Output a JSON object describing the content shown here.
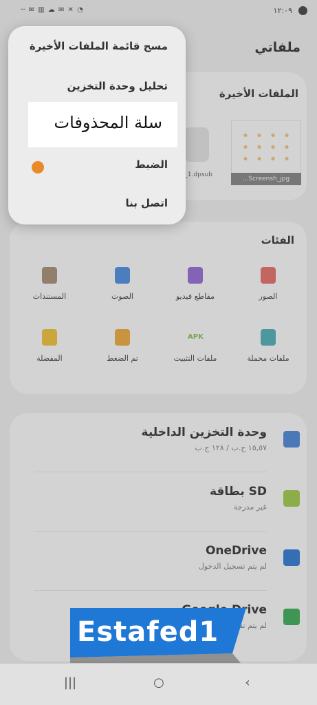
{
  "status_bar": {
    "time": "١٢:٠٩",
    "left_icons": "ⵈ ✉ ▥ ☁ ✉ ✕ ◔"
  },
  "app": {
    "title": "ملفاتي"
  },
  "recent": {
    "title": "الملفات الأخيرة",
    "file_1_name": "...Screensh_jpg",
    "file_2_name": "...5_1.dpsub"
  },
  "categories": {
    "title": "الفئات",
    "items": [
      {
        "label": "الصور",
        "icon": "image-icon",
        "color": "#e8625b"
      },
      {
        "label": "مقاطع فيديو",
        "icon": "video-icon",
        "color": "#8c5fd6"
      },
      {
        "label": "الصوت",
        "icon": "music-icon",
        "color": "#3b86e0"
      },
      {
        "label": "المستندات",
        "icon": "document-icon",
        "color": "#a4846a"
      },
      {
        "label": "ملفات محملة",
        "icon": "download-icon",
        "color": "#3fa9b5"
      },
      {
        "label": "ملفات التثبيت",
        "icon": "apk-icon",
        "color": "#7cc04a",
        "icon_text": "APK"
      },
      {
        "label": "تم الضغط",
        "icon": "folder-icon",
        "color": "#f0a52a"
      },
      {
        "label": "المفضلة",
        "icon": "star-icon",
        "color": "#f2c029"
      }
    ]
  },
  "storage": {
    "items": [
      {
        "name": "وحدة التخزين الداخلية",
        "sub": "١٥,٥٧ ج.ب / ١٢٨ ج.ب",
        "icon": "phone-storage-icon",
        "color": "#3d7fd9"
      },
      {
        "name": "بطاقة SD",
        "sub": "غير مدرجة",
        "icon": "sd-card-icon",
        "color": "#9bc93c"
      },
      {
        "name": "OneDrive",
        "sub": "لم يتم تسجيل الدخول",
        "icon": "onedrive-icon",
        "color": "#1d6fd1"
      },
      {
        "name": "Google Drive",
        "sub": "لم يتم تسجيل الدخول",
        "icon": "google-drive-icon",
        "color": "#2ba84a"
      }
    ]
  },
  "menu": {
    "items": [
      "مسح قائمة الملفات الأخيرة",
      "تحليل وحدة التخزين",
      "سلة المحذوفات",
      "الضبط",
      "اتصل بنا"
    ],
    "highlighted_index": 2,
    "badge_color": "#e98a2a"
  },
  "nav": {
    "recent": "|||",
    "home": "○",
    "back": "‹"
  },
  "watermark": {
    "text": "Estafed1",
    "color": "#1f78d6"
  }
}
